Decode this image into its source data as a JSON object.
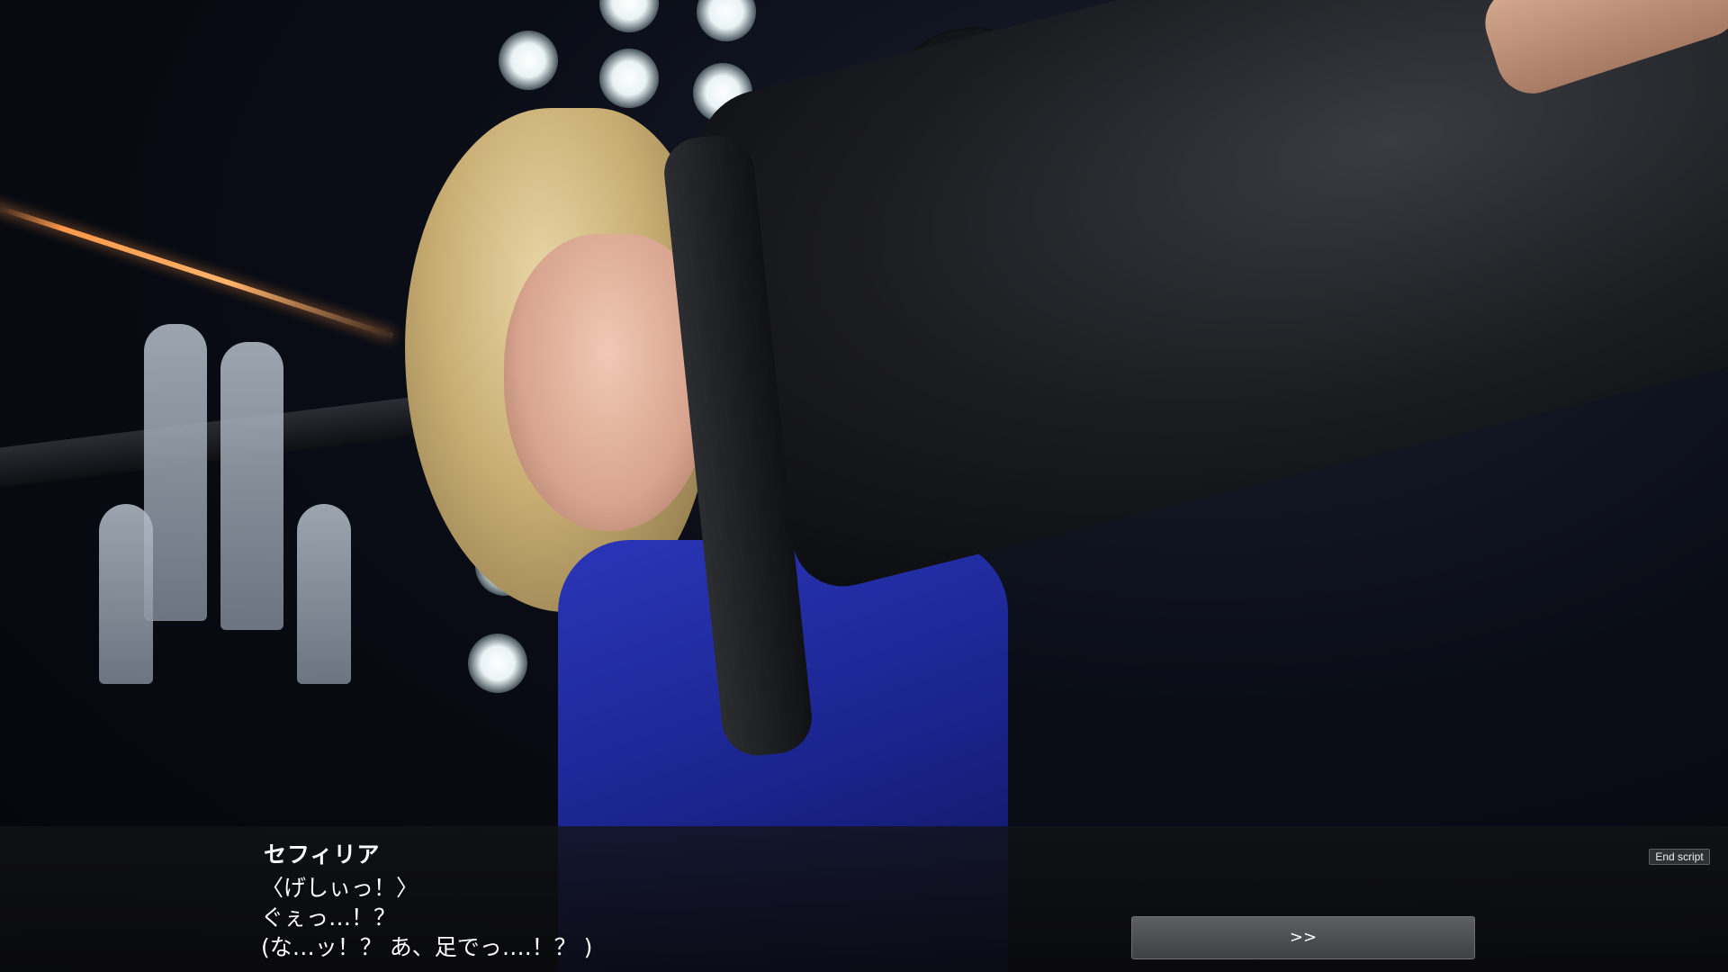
{
  "dialogue": {
    "speaker": "セフィリア",
    "lines": [
      "〈げしぃっ！〉",
      "ぐぇっ…！？",
      "(な…ッ！？ あ、足でっ….！？ )"
    ]
  },
  "controls": {
    "end_script_label": "End script",
    "next_label": ">>"
  },
  "colors": {
    "dialogue_bar": "#121316",
    "button_face": "#4e5054",
    "text": "#ffffff"
  }
}
